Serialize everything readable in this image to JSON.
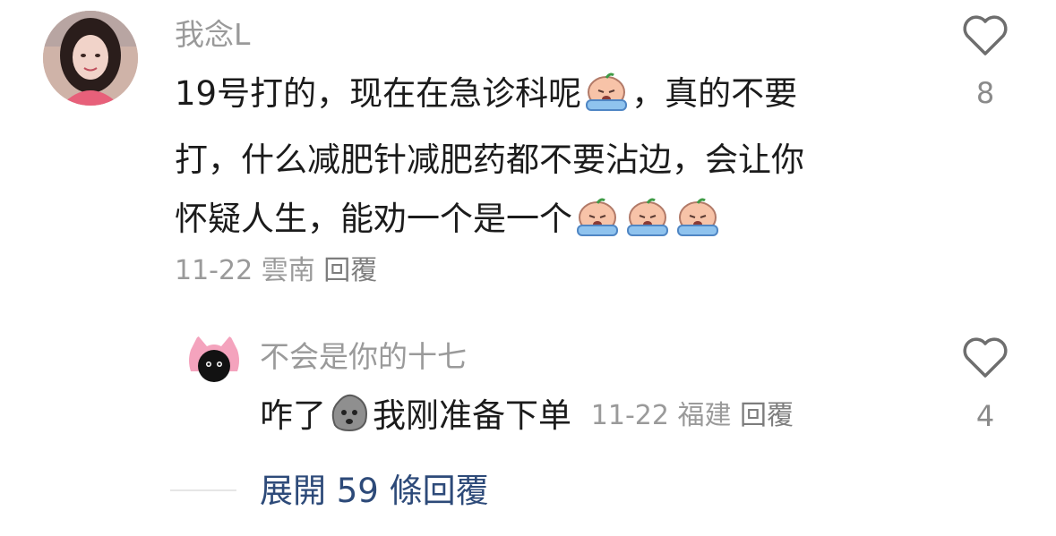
{
  "comment": {
    "username": "我念L",
    "lines": [
      {
        "before": "19号打的，现在在急诊科呢",
        "after": "，真的不要"
      },
      {
        "text": "打，什么减肥针减肥药都不要沾边，会让你"
      },
      {
        "text": "怀疑人生，能劝一个是一个"
      }
    ],
    "meta": {
      "date": "11-22",
      "location": "雲南",
      "reply_label": "回覆"
    },
    "like_count": "8",
    "emoji_name": "crying-baby-emoji"
  },
  "reply": {
    "username": "不会是你的十七",
    "text_before": "咋了",
    "text_after": "我刚准备下单",
    "meta": {
      "date": "11-22",
      "location": "福建",
      "reply_label": "回覆"
    },
    "like_count": "4",
    "emoji_name": "stone-face-emoji"
  },
  "expand": {
    "label": "展開 59 條回覆"
  },
  "colors": {
    "username": "#9a9a9a",
    "text": "#1b1b1b",
    "expand_link": "#2d4a79",
    "avatar2_pink": "#f4a3bd"
  }
}
